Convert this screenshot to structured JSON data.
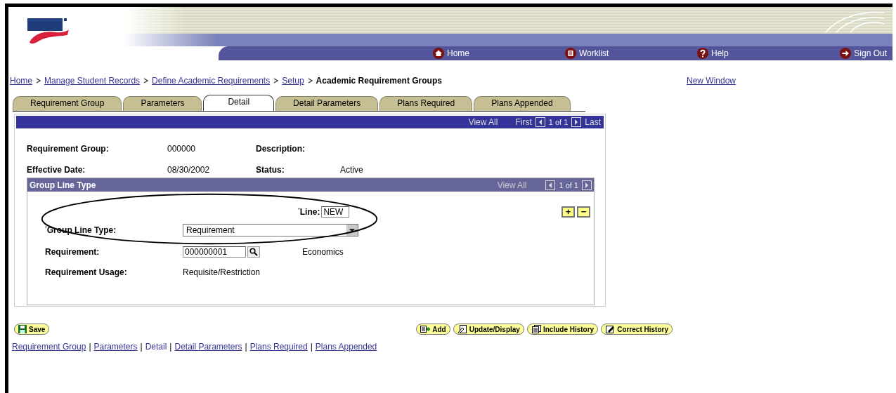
{
  "nav": [
    {
      "kind": "home",
      "label": "Home"
    },
    {
      "kind": "worklist",
      "label": "Worklist"
    },
    {
      "kind": "help",
      "label": "Help"
    },
    {
      "kind": "signout",
      "label": "Sign Out"
    }
  ],
  "breadcrumb": [
    {
      "label": "Home",
      "link": true
    },
    {
      "label": "Manage Student Records",
      "link": true
    },
    {
      "label": "Define Academic Requirements",
      "link": true
    },
    {
      "label": "Setup",
      "link": true
    },
    {
      "label": "Academic Requirement Groups",
      "link": false
    }
  ],
  "new_window": "New Window",
  "tabs": [
    {
      "label": "Requirement Group",
      "selected": false
    },
    {
      "label": "Parameters",
      "selected": false
    },
    {
      "label": "Detail",
      "selected": true
    },
    {
      "label": "Detail Parameters",
      "selected": false
    },
    {
      "label": "Plans Required",
      "selected": false
    },
    {
      "label": "Plans Appended",
      "selected": false
    }
  ],
  "panel_nav": {
    "view_all": "View All",
    "first": "First",
    "count": "1 of 1",
    "last": "Last"
  },
  "fields": [
    {
      "label": "Requirement Group:",
      "value": "000000",
      "label2": "Description:"
    },
    {
      "label": "Effective Date:",
      "value": "08/30/2002",
      "label2": "Status:",
      "value2": "Active"
    }
  ],
  "group": {
    "title": "Group Line Type",
    "view_all": "View All",
    "count": "1 of 1",
    "add": "+",
    "remove": "−",
    "line_label": "Line:",
    "line_value": "NEW",
    "required_mark": "*",
    "type_label": "Group Line Type:",
    "type_value": "Requirement",
    "req_label": "Requirement:",
    "req_value": "000000001",
    "req_desc": "Economics",
    "usage_label": "Requirement Usage:",
    "usage_value": "Requisite/Restriction"
  },
  "save": "Save",
  "actions": [
    {
      "kind": "add",
      "label": "Add"
    },
    {
      "kind": "update",
      "label": "Update/Display"
    },
    {
      "kind": "include",
      "label": "Include History"
    },
    {
      "kind": "correct",
      "label": "Correct History"
    }
  ],
  "footer_links": [
    {
      "label": "Requirement Group",
      "link": true
    },
    {
      "separator": "|",
      "label": "Parameters",
      "link": true
    },
    {
      "separator": "|",
      "label": "Detail",
      "link": false
    },
    {
      "separator": "|",
      "label": "Detail Parameters",
      "link": true
    },
    {
      "separator": "|",
      "label": "Plans Required",
      "link": true
    },
    {
      "separator": "|",
      "label": "Plans Appended",
      "link": true
    }
  ]
}
